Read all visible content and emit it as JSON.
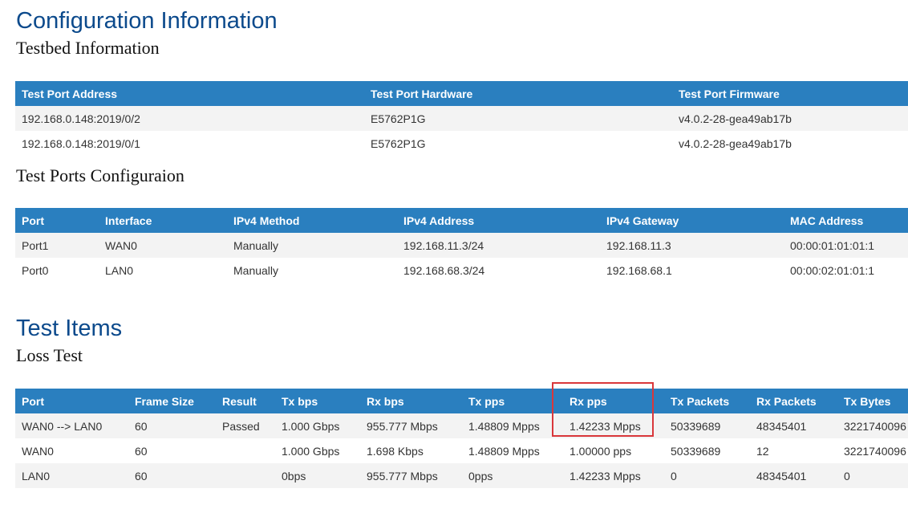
{
  "config": {
    "title": "Configuration Information",
    "testbed": {
      "subtitle": "Testbed Information",
      "headers": [
        "Test Port Address",
        "Test Port Hardware",
        "Test Port Firmware"
      ],
      "rows": [
        [
          "192.168.0.148:2019/0/2",
          "E5762P1G",
          "v4.0.2-28-gea49ab17b"
        ],
        [
          "192.168.0.148:2019/0/1",
          "E5762P1G",
          "v4.0.2-28-gea49ab17b"
        ]
      ]
    },
    "ports": {
      "subtitle": "Test Ports Configuraion",
      "headers": [
        "Port",
        "Interface",
        "IPv4 Method",
        "IPv4 Address",
        "IPv4 Gateway",
        "MAC Address"
      ],
      "rows": [
        [
          "Port1",
          "WAN0",
          "Manually",
          "192.168.11.3/24",
          "192.168.11.3",
          "00:00:01:01:01:1"
        ],
        [
          "Port0",
          "LAN0",
          "Manually",
          "192.168.68.3/24",
          "192.168.68.1",
          "00:00:02:01:01:1"
        ]
      ]
    }
  },
  "test_items": {
    "title": "Test Items",
    "loss": {
      "subtitle": "Loss Test",
      "headers": [
        "Port",
        "Frame Size",
        "Result",
        "Tx bps",
        "Rx bps",
        "Tx pps",
        "Rx pps",
        "Tx Packets",
        "Rx Packets",
        "Tx Bytes"
      ],
      "rows": [
        [
          "WAN0 --> LAN0",
          "60",
          "Passed",
          "1.000 Gbps",
          "955.777 Mbps",
          "1.48809 Mpps",
          "1.42233 Mpps",
          "50339689",
          "48345401",
          "3221740096"
        ],
        [
          "WAN0",
          "60",
          "",
          "1.000 Gbps",
          "1.698 Kbps",
          "1.48809 Mpps",
          "1.00000 pps",
          "50339689",
          "12",
          "3221740096"
        ],
        [
          "LAN0",
          "60",
          "",
          "0bps",
          "955.777 Mbps",
          "0pps",
          "1.42233 Mpps",
          "0",
          "48345401",
          "0"
        ]
      ]
    }
  },
  "colors": {
    "heading": "#0c4a8c",
    "table_header_bg": "#2a7fbf",
    "row_stripe": "#f3f3f3",
    "highlight_box": "#d9373b"
  }
}
